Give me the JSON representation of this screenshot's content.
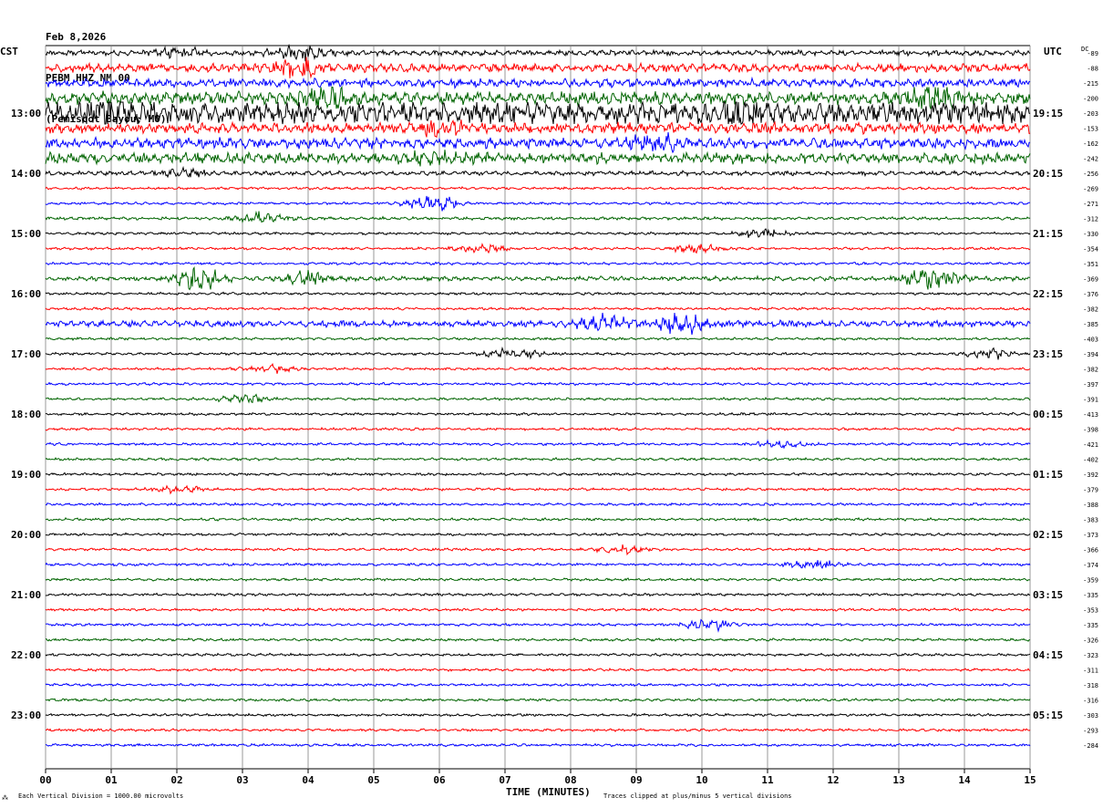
{
  "header": {
    "date": "Feb 8,2026",
    "station": "PEBM HHZ NM 00",
    "location": "(Pemiscot Bayou, MO)"
  },
  "left_timezone": "CST",
  "right_timezone": "UTC",
  "dc_label": "DC",
  "footer": {
    "scale_note": "Each Vertical Division = 1000.00 microvolts",
    "clip_note": "Traces clipped at plus/minus 5 vertical divisions",
    "corner_mark": "⁂"
  },
  "colors": {
    "black": "#000000",
    "red": "#ff0000",
    "blue": "#0000ff",
    "green": "#006400",
    "grid": "#808080"
  },
  "chart_data": {
    "type": "line",
    "title": "",
    "xlabel": "TIME (MINUTES)",
    "ylabel": "",
    "xlim": [
      0,
      15
    ],
    "x_ticks": [
      "00",
      "01",
      "02",
      "03",
      "04",
      "05",
      "06",
      "07",
      "08",
      "09",
      "10",
      "11",
      "12",
      "13",
      "14",
      "15"
    ],
    "grid": true,
    "legend": "none",
    "trace_colors_cycle": [
      "black",
      "red",
      "blue",
      "green"
    ],
    "left_hour_labels": [
      "13:00",
      "14:00",
      "15:00",
      "16:00",
      "17:00",
      "18:00",
      "19:00",
      "20:00",
      "21:00",
      "22:00",
      "23:00"
    ],
    "right_hour_labels": [
      "19:15",
      "20:15",
      "21:15",
      "22:15",
      "23:15",
      "00:15",
      "01:15",
      "02:15",
      "03:15",
      "04:15",
      "05:15"
    ],
    "first_labeled_row": 4,
    "dc_offsets": [
      -89,
      -88,
      -215,
      -200,
      -203,
      -153,
      -162,
      -242,
      -256,
      -269,
      -271,
      -312,
      -330,
      -354,
      -351,
      -369,
      -376,
      -382,
      -385,
      -403,
      -394,
      -382,
      -397,
      -391,
      -413,
      -398,
      -421,
      -402,
      -392,
      -379,
      -388,
      -383,
      -373,
      -366,
      -374,
      -359,
      -335,
      -353,
      -335,
      -326,
      -323,
      -311,
      -318,
      -316,
      -303,
      -293,
      -284
    ],
    "trace_noise_level": [
      2.5,
      4,
      4,
      6,
      10,
      5,
      5,
      5,
      2,
      1.2,
      1.2,
      1.4,
      1.2,
      1.2,
      1.2,
      2,
      1.2,
      1.2,
      3,
      1.2,
      1.2,
      1.2,
      1.2,
      1.2,
      1.2,
      1.2,
      1.2,
      1.2,
      1.2,
      1.2,
      1.2,
      1.2,
      1.2,
      1.2,
      1.2,
      1.2,
      1.2,
      1.2,
      1.2,
      1.2,
      1.2,
      1.2,
      1.2,
      1.2,
      1.2,
      1.2,
      1.2
    ],
    "events": [
      {
        "row": 0,
        "minute": 3.8,
        "amp": 6
      },
      {
        "row": 0,
        "minute": 2.0,
        "amp": 4
      },
      {
        "row": 1,
        "minute": 3.9,
        "amp": 8
      },
      {
        "row": 3,
        "minute": 4.3,
        "amp": 8
      },
      {
        "row": 3,
        "minute": 13.5,
        "amp": 12
      },
      {
        "row": 4,
        "minute": 1.0,
        "amp": 12
      },
      {
        "row": 4,
        "minute": 10.4,
        "amp": 7
      },
      {
        "row": 5,
        "minute": 6.0,
        "amp": 6
      },
      {
        "row": 6,
        "minute": 9.3,
        "amp": 6
      },
      {
        "row": 7,
        "minute": 6.0,
        "amp": 6
      },
      {
        "row": 8,
        "minute": 2.1,
        "amp": 4
      },
      {
        "row": 10,
        "minute": 5.9,
        "amp": 8
      },
      {
        "row": 11,
        "minute": 3.3,
        "amp": 5
      },
      {
        "row": 12,
        "minute": 10.9,
        "amp": 4
      },
      {
        "row": 13,
        "minute": 6.6,
        "amp": 4
      },
      {
        "row": 13,
        "minute": 9.9,
        "amp": 4
      },
      {
        "row": 15,
        "minute": 2.3,
        "amp": 10
      },
      {
        "row": 15,
        "minute": 4.0,
        "amp": 6
      },
      {
        "row": 15,
        "minute": 13.5,
        "amp": 10
      },
      {
        "row": 18,
        "minute": 9.7,
        "amp": 9
      },
      {
        "row": 18,
        "minute": 8.5,
        "amp": 6
      },
      {
        "row": 20,
        "minute": 7.1,
        "amp": 5
      },
      {
        "row": 20,
        "minute": 14.4,
        "amp": 4
      },
      {
        "row": 21,
        "minute": 3.4,
        "amp": 3
      },
      {
        "row": 23,
        "minute": 3.0,
        "amp": 4
      },
      {
        "row": 26,
        "minute": 11.2,
        "amp": 3
      },
      {
        "row": 29,
        "minute": 2.0,
        "amp": 3
      },
      {
        "row": 33,
        "minute": 8.8,
        "amp": 3
      },
      {
        "row": 34,
        "minute": 11.7,
        "amp": 4
      },
      {
        "row": 38,
        "minute": 10.1,
        "amp": 5
      }
    ]
  }
}
